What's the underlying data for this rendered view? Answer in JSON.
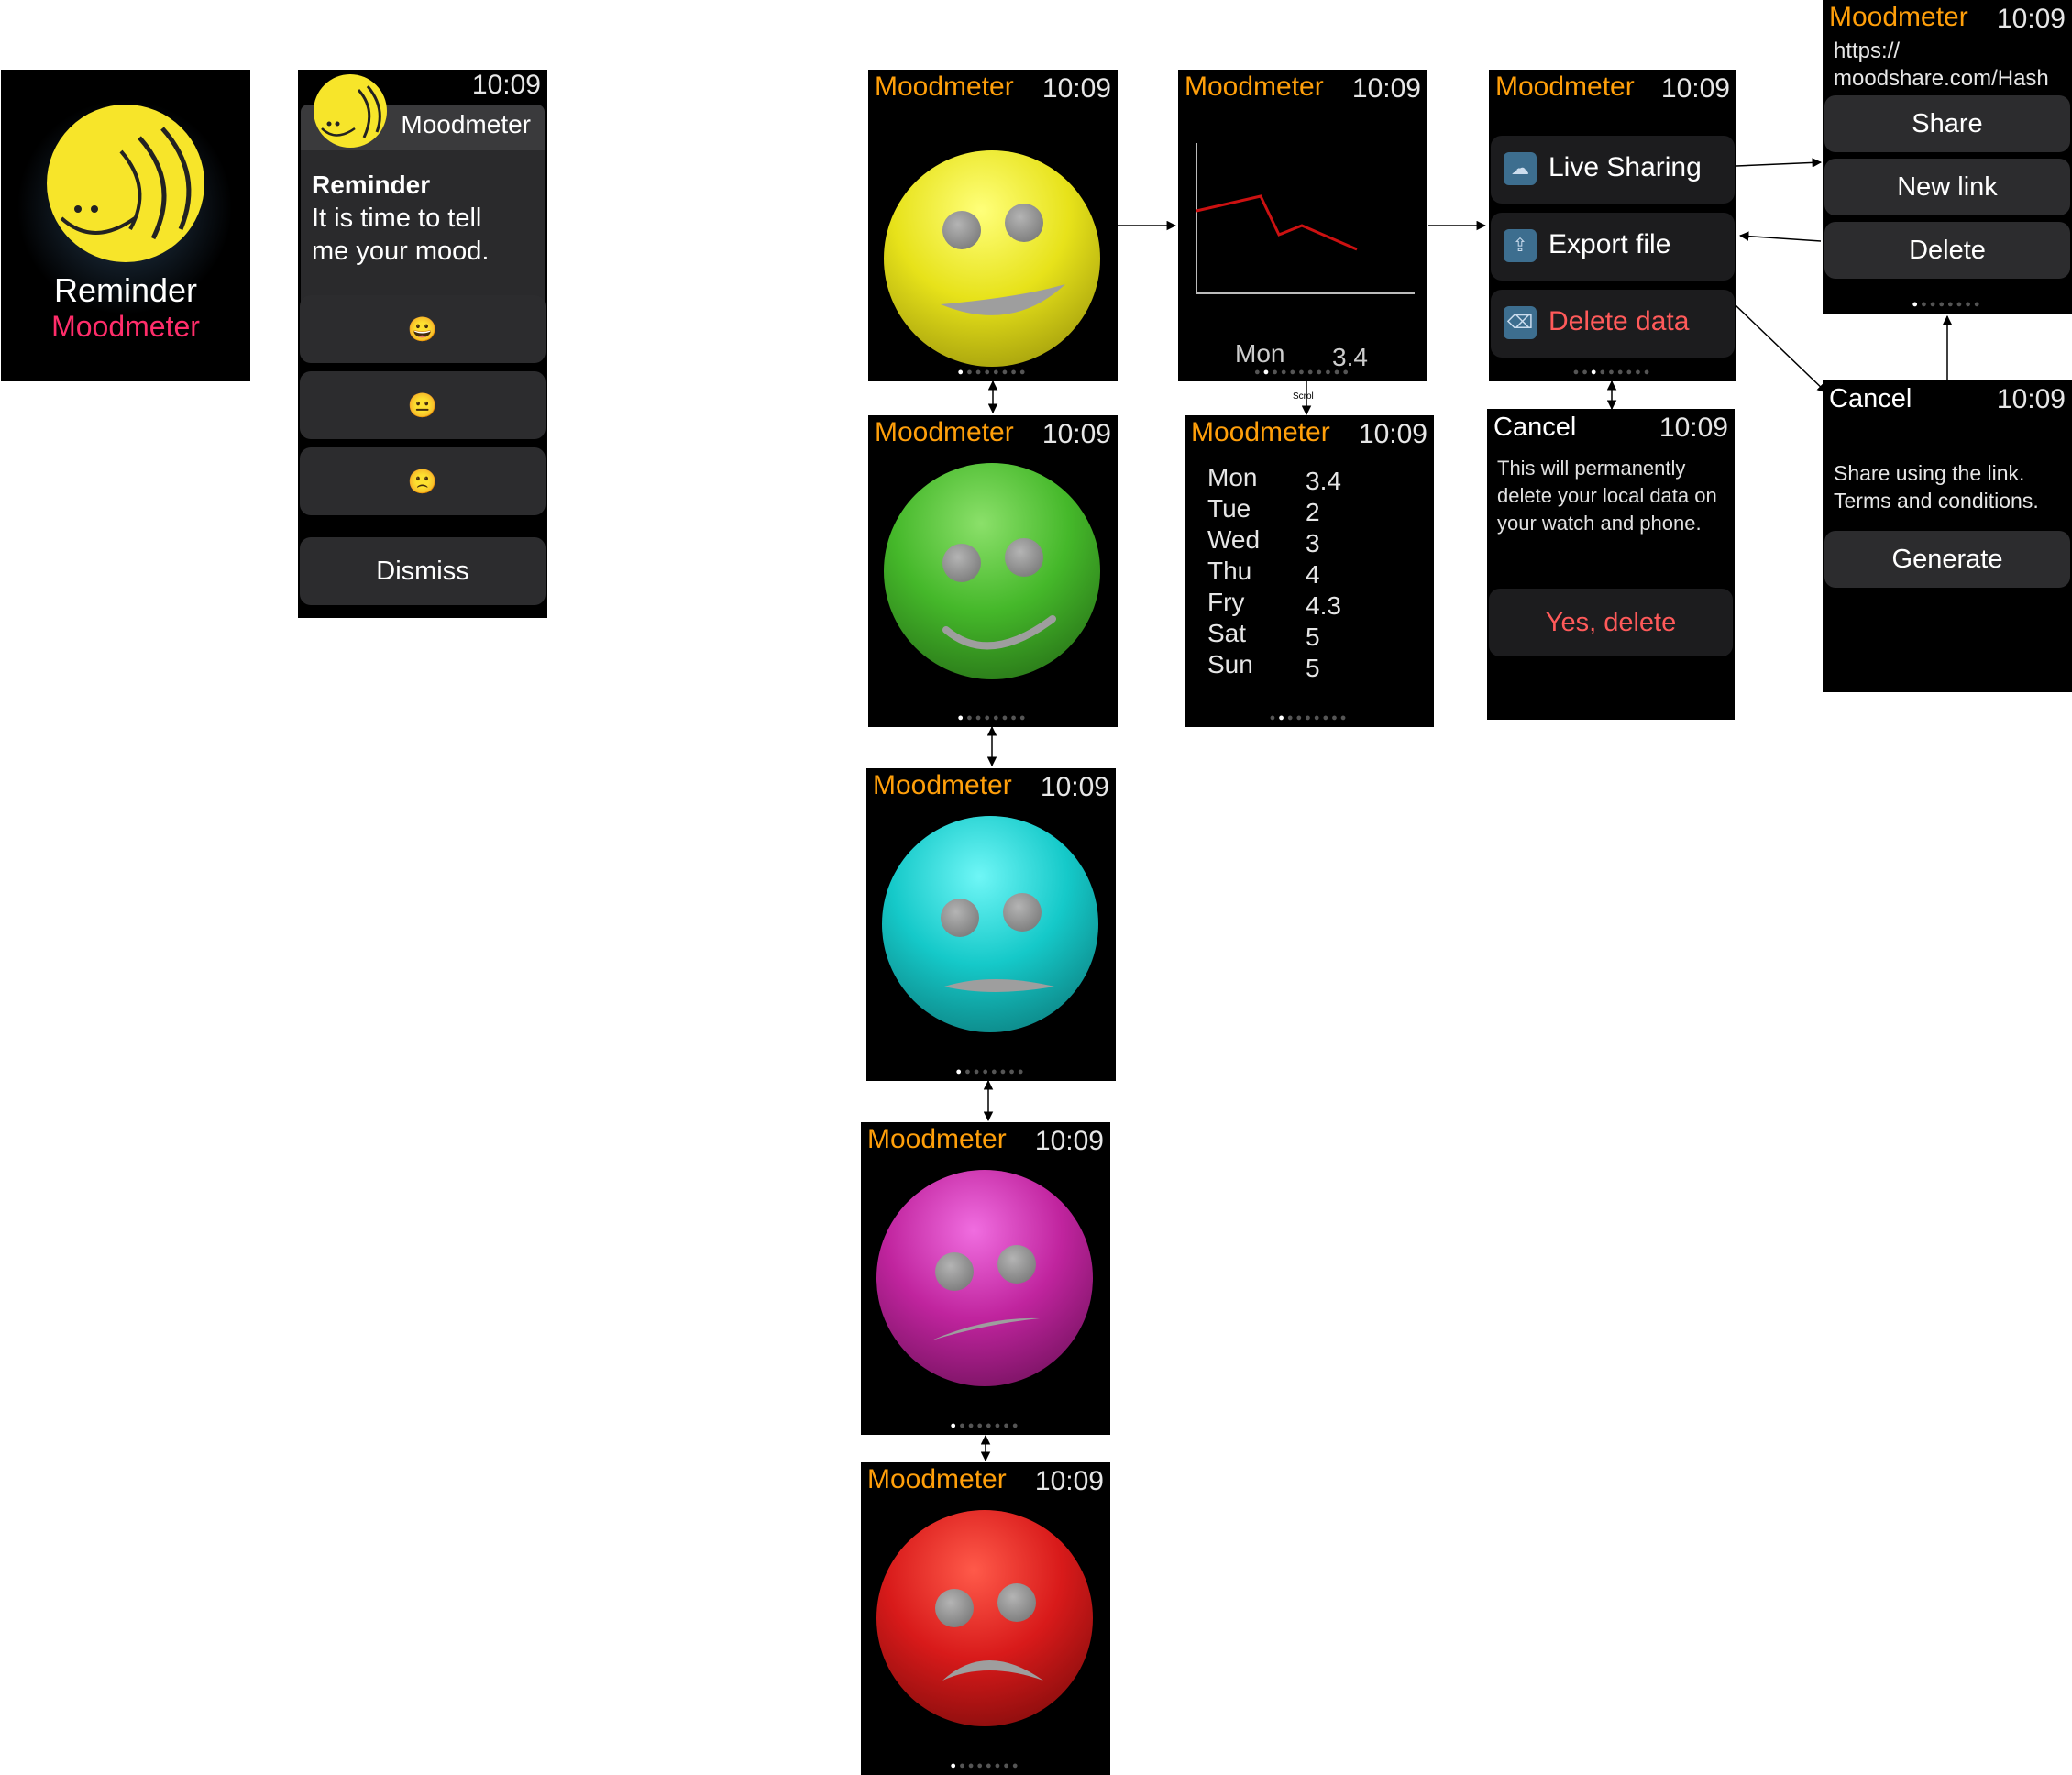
{
  "colors": {
    "accent": "#ff9f0a",
    "destructive": "#ff5a5a",
    "notification_pink": "#ff2d6a"
  },
  "app_name": "Moodmeter",
  "time": "10:09",
  "reminder_glance": {
    "title": "Reminder",
    "subtitle": "Moodmeter"
  },
  "notification": {
    "time": "10:09",
    "app": "Moodmeter",
    "heading": "Reminder",
    "body": "It is time to tell me your mood.",
    "emojis": [
      "😀",
      "😐",
      "🙁"
    ],
    "dismiss": "Dismiss"
  },
  "faces": [
    {
      "mood": "happy",
      "color": "#e7e21a"
    },
    {
      "mood": "content",
      "color": "#45b82a"
    },
    {
      "mood": "neutral",
      "color": "#15c9c9"
    },
    {
      "mood": "sad",
      "color": "#c0249e"
    },
    {
      "mood": "very-sad",
      "color": "#d81a1a"
    }
  ],
  "chart_screen": {
    "day": "Mon",
    "value": "3.4",
    "scroll_label": "Scrol"
  },
  "chart_data": {
    "type": "line",
    "title": "",
    "xlabel": "",
    "ylabel": "",
    "x": [
      "Mon",
      "Tue",
      "Wed",
      "Thu",
      "Fry",
      "Sat",
      "Sun"
    ],
    "series": [
      {
        "values": [
          3.4,
          2,
          3,
          4,
          4.3,
          5,
          5
        ]
      }
    ],
    "line_color": "#cc1111",
    "grid": false
  },
  "table": {
    "rows": [
      {
        "day": "Mon",
        "value": "3.4"
      },
      {
        "day": "Tue",
        "value": "2"
      },
      {
        "day": "Wed",
        "value": "3"
      },
      {
        "day": "Thu",
        "value": "4"
      },
      {
        "day": "Fry",
        "value": "4.3"
      },
      {
        "day": "Sat",
        "value": "5"
      },
      {
        "day": "Sun",
        "value": "5"
      }
    ]
  },
  "menu": {
    "items": [
      {
        "label": "Live Sharing",
        "icon": "cloud-icon"
      },
      {
        "label": "Export file",
        "icon": "share-icon"
      },
      {
        "label": "Delete data",
        "icon": "delete-icon"
      }
    ]
  },
  "delete_confirm": {
    "cancel": "Cancel",
    "message": "This will permanently delete your local data on your watch and phone.",
    "confirm": "Yes, delete"
  },
  "sharing": {
    "link_line1": "https://",
    "link_line2": "moodshare.com/Hash",
    "share": "Share",
    "new_link": "New link",
    "delete": "Delete"
  },
  "generate_screen": {
    "cancel": "Cancel",
    "text": "Share using the link. Terms and conditions.",
    "generate": "Generate"
  }
}
